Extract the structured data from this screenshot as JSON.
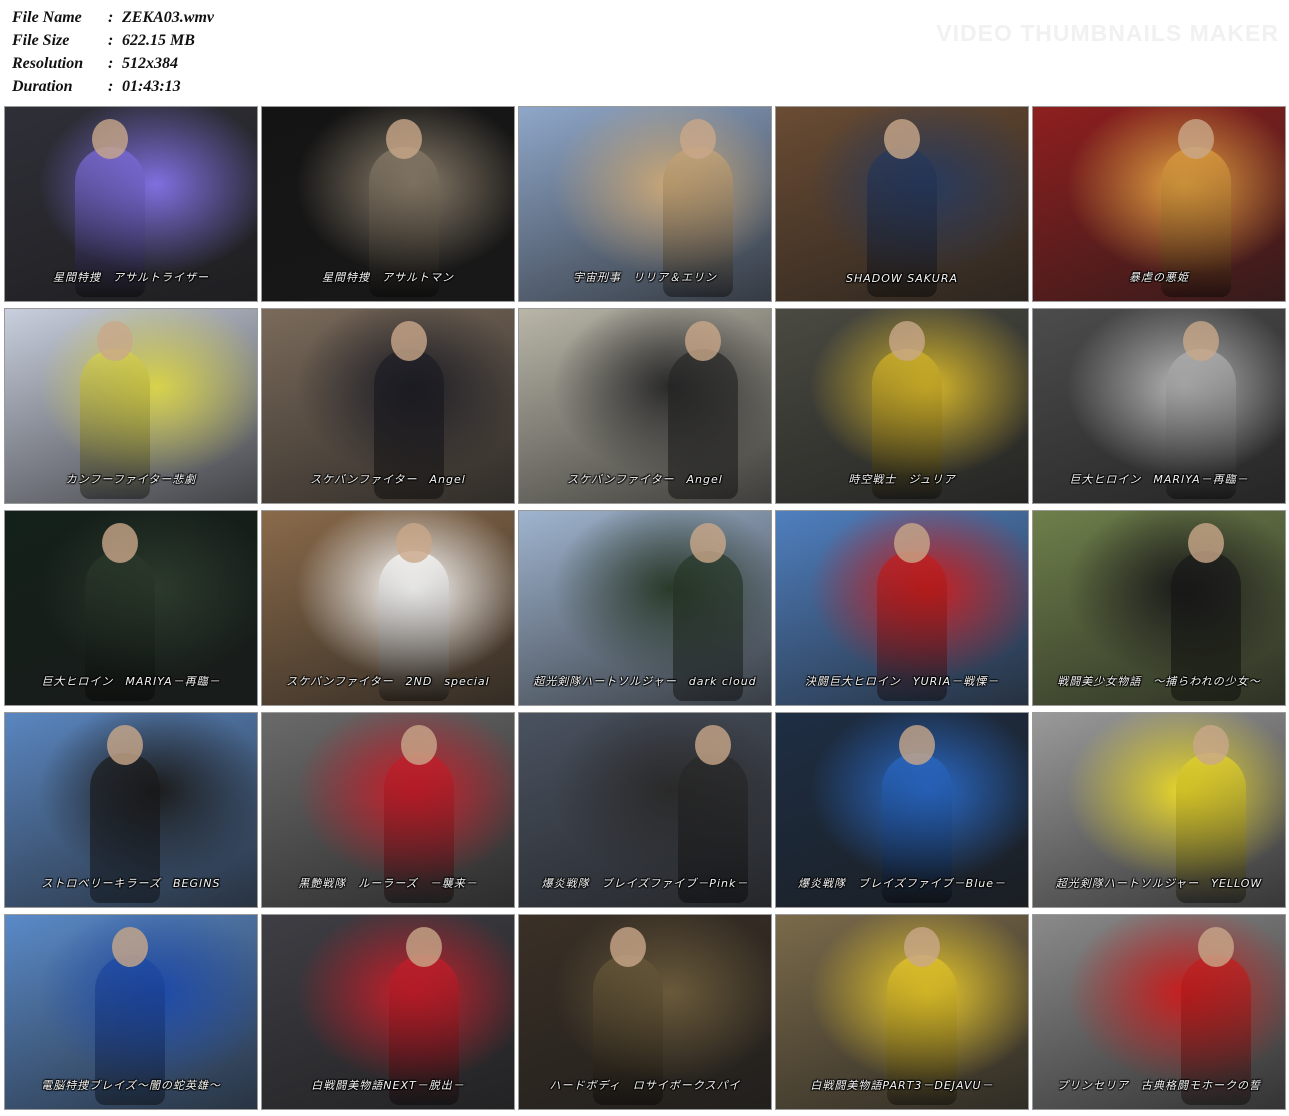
{
  "info": {
    "rows": [
      {
        "key": "File Name",
        "sep": ":",
        "value": "ZEKA03.wmv"
      },
      {
        "key": "File Size",
        "sep": ":",
        "value": "622.15 MB"
      },
      {
        "key": "Resolution",
        "sep": ":",
        "value": "512x384"
      },
      {
        "key": "Duration",
        "sep": ":",
        "value": "01:43:13"
      }
    ]
  },
  "watermark": "VIDEO THUMBNAILS MAKER",
  "thumbnails": [
    {
      "caption": "星間特捜　アサルトライザー",
      "bg": "#2f2f38",
      "accent": "#7f6fe0"
    },
    {
      "caption": "星間特捜　アサルトマン",
      "bg": "#141414",
      "accent": "#8a7d6a"
    },
    {
      "caption": "宇宙刑事　リリア＆エリン",
      "bg": "#8fa7c9",
      "accent": "#c9a777"
    },
    {
      "caption": "SHADOW SAKURA",
      "bg": "#6a4c33",
      "accent": "#283a5e"
    },
    {
      "caption": "暴虐の悪姫",
      "bg": "#8f1f1f",
      "accent": "#e0a040"
    },
    {
      "caption": "カンフーファイター悲劇",
      "bg": "#c9cfde",
      "accent": "#d8d24a"
    },
    {
      "caption": "スケバンファイター　Angel",
      "bg": "#7a6a5a",
      "accent": "#1e1e26"
    },
    {
      "caption": "スケバンファイター　Angel",
      "bg": "#b9b6a8",
      "accent": "#2a2a2a"
    },
    {
      "caption": "時空戦士　ジュリア",
      "bg": "#4a4a42",
      "accent": "#d6b62a"
    },
    {
      "caption": "巨大ヒロイン　MARIYA－再臨－",
      "bg": "#4c4c4c",
      "accent": "#b4b4b4"
    },
    {
      "caption": "巨大ヒロイン　MARIYA－再臨－",
      "bg": "#14201a",
      "accent": "#2c3a2c"
    },
    {
      "caption": "スケバンファイター　2ND　special",
      "bg": "#8a6a4a",
      "accent": "#ffffff"
    },
    {
      "caption": "超光剣隊ハートソルジャー　dark cloud",
      "bg": "#9fb4cf",
      "accent": "#2a3a2a"
    },
    {
      "caption": "決闘巨大ヒロイン　YURIA－戦慄－",
      "bg": "#4f7fbf",
      "accent": "#c81e1e"
    },
    {
      "caption": "戦闘美少女物語　～捕らわれの少女～",
      "bg": "#6e7f4a",
      "accent": "#1a1a1a"
    },
    {
      "caption": "ストロベリーキラーズ　BEGINS",
      "bg": "#5a86c0",
      "accent": "#1c1c1c"
    },
    {
      "caption": "黒艶戦隊　ルーラーズ　－襲来－",
      "bg": "#6a6a6a",
      "accent": "#c81e2a"
    },
    {
      "caption": "爆炎戦隊　ブレイズファイブ－Pink－",
      "bg": "#4a5260",
      "accent": "#2a2a2a"
    },
    {
      "caption": "爆炎戦隊　ブレイズファイブ－Blue－",
      "bg": "#1e2e44",
      "accent": "#2a6ac8"
    },
    {
      "caption": "超光剣隊ハートソルジャー　YELLOW",
      "bg": "#9a9a9a",
      "accent": "#e8d62a"
    },
    {
      "caption": "電脳特捜ブレイズ～闇の蛇英雄～",
      "bg": "#5a8ac8",
      "accent": "#1e4aa8"
    },
    {
      "caption": "白戦闘美物語NEXT－脱出－",
      "bg": "#3e3e44",
      "accent": "#c81e2a"
    },
    {
      "caption": "ハードボディ　ロサイボークスパイ",
      "bg": "#3a3026",
      "accent": "#6a5a3a"
    },
    {
      "caption": "白戦闘美物語PART3－DEJAVU－",
      "bg": "#7a6a4a",
      "accent": "#e8c82a"
    },
    {
      "caption": "プリンセリア　古典格闘モホークの誓",
      "bg": "#8a8a8a",
      "accent": "#c81e1e"
    }
  ]
}
